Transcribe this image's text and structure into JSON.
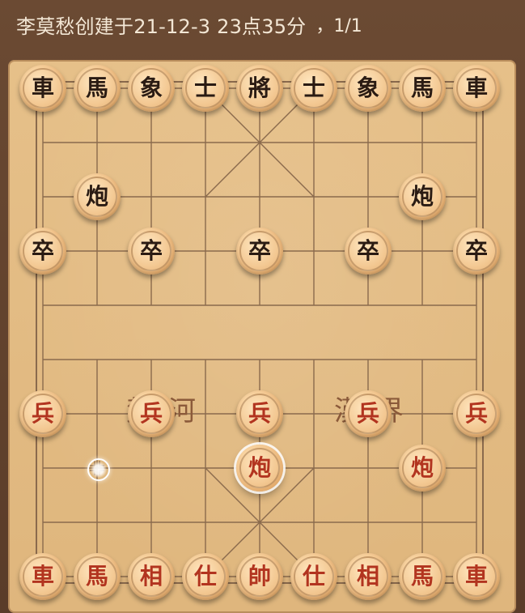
{
  "header": {
    "title": "李莫愁创建于21-12-3 23点35分",
    "page": "，1/1"
  },
  "river": {
    "left": "楚河",
    "right": "漢界"
  },
  "colors": {
    "red_piece_text": "#b2341f",
    "black_piece_text": "#2a1b13",
    "board": "#e2bb82",
    "line": "#8a6a4d"
  },
  "pieces": [
    {
      "id": "b-chariot-left",
      "glyph": "車",
      "side": "black",
      "col": 0,
      "row": 0
    },
    {
      "id": "b-horse-left",
      "glyph": "馬",
      "side": "black",
      "col": 1,
      "row": 0
    },
    {
      "id": "b-elephant-left",
      "glyph": "象",
      "side": "black",
      "col": 2,
      "row": 0
    },
    {
      "id": "b-advisor-left",
      "glyph": "士",
      "side": "black",
      "col": 3,
      "row": 0
    },
    {
      "id": "b-general",
      "glyph": "將",
      "side": "black",
      "col": 4,
      "row": 0
    },
    {
      "id": "b-advisor-right",
      "glyph": "士",
      "side": "black",
      "col": 5,
      "row": 0
    },
    {
      "id": "b-elephant-right",
      "glyph": "象",
      "side": "black",
      "col": 6,
      "row": 0
    },
    {
      "id": "b-horse-right",
      "glyph": "馬",
      "side": "black",
      "col": 7,
      "row": 0
    },
    {
      "id": "b-chariot-right",
      "glyph": "車",
      "side": "black",
      "col": 8,
      "row": 0
    },
    {
      "id": "b-cannon-left",
      "glyph": "炮",
      "side": "black",
      "col": 1,
      "row": 2
    },
    {
      "id": "b-cannon-right",
      "glyph": "炮",
      "side": "black",
      "col": 7,
      "row": 2
    },
    {
      "id": "b-soldier-1",
      "glyph": "卒",
      "side": "black",
      "col": 0,
      "row": 3
    },
    {
      "id": "b-soldier-2",
      "glyph": "卒",
      "side": "black",
      "col": 2,
      "row": 3
    },
    {
      "id": "b-soldier-3",
      "glyph": "卒",
      "side": "black",
      "col": 4,
      "row": 3
    },
    {
      "id": "b-soldier-4",
      "glyph": "卒",
      "side": "black",
      "col": 6,
      "row": 3
    },
    {
      "id": "b-soldier-5",
      "glyph": "卒",
      "side": "black",
      "col": 8,
      "row": 3
    },
    {
      "id": "r-soldier-1",
      "glyph": "兵",
      "side": "red",
      "col": 0,
      "row": 6
    },
    {
      "id": "r-soldier-2",
      "glyph": "兵",
      "side": "red",
      "col": 2,
      "row": 6
    },
    {
      "id": "r-soldier-3",
      "glyph": "兵",
      "side": "red",
      "col": 4,
      "row": 6
    },
    {
      "id": "r-soldier-4",
      "glyph": "兵",
      "side": "red",
      "col": 6,
      "row": 6
    },
    {
      "id": "r-soldier-5",
      "glyph": "兵",
      "side": "red",
      "col": 8,
      "row": 6
    },
    {
      "id": "r-cannon-center",
      "glyph": "炮",
      "side": "red",
      "col": 4,
      "row": 7,
      "selected": true
    },
    {
      "id": "r-cannon-right",
      "glyph": "炮",
      "side": "red",
      "col": 7,
      "row": 7
    },
    {
      "id": "r-chariot-left",
      "glyph": "車",
      "side": "red",
      "col": 0,
      "row": 9
    },
    {
      "id": "r-horse-left",
      "glyph": "馬",
      "side": "red",
      "col": 1,
      "row": 9
    },
    {
      "id": "r-elephant-left",
      "glyph": "相",
      "side": "red",
      "col": 2,
      "row": 9
    },
    {
      "id": "r-advisor-left",
      "glyph": "仕",
      "side": "red",
      "col": 3,
      "row": 9
    },
    {
      "id": "r-general",
      "glyph": "帥",
      "side": "red",
      "col": 4,
      "row": 9
    },
    {
      "id": "r-advisor-right",
      "glyph": "仕",
      "side": "red",
      "col": 5,
      "row": 9
    },
    {
      "id": "r-elephant-right",
      "glyph": "相",
      "side": "red",
      "col": 6,
      "row": 9
    },
    {
      "id": "r-horse-right",
      "glyph": "馬",
      "side": "red",
      "col": 7,
      "row": 9
    },
    {
      "id": "r-chariot-right",
      "glyph": "車",
      "side": "red",
      "col": 8,
      "row": 9
    }
  ],
  "marker": {
    "col": 1,
    "row": 7,
    "type": "last-move-origin"
  }
}
